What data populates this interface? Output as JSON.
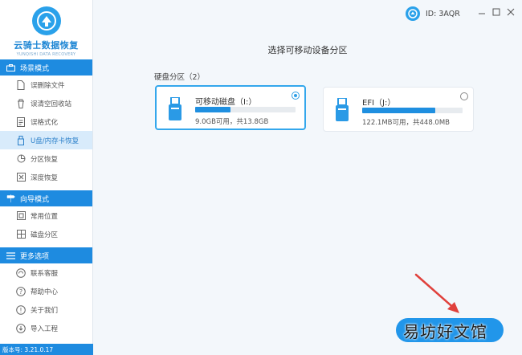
{
  "app": {
    "name": "云骑士数据恢复",
    "subtitle": "YUNQISHI DATA RECOVERY",
    "version_label": "版本号: 3.21.0.17"
  },
  "sidebar": {
    "sections": [
      {
        "title": "场景模式",
        "icon": "briefcase-icon",
        "items": [
          {
            "label": "误删除文件",
            "icon": "document-icon"
          },
          {
            "label": "误清空回收站",
            "icon": "recycle-bin-icon"
          },
          {
            "label": "误格式化",
            "icon": "format-icon"
          },
          {
            "label": "U盘/内存卡恢复",
            "icon": "usb-drive-icon",
            "active": true
          },
          {
            "label": "分区恢复",
            "icon": "partition-icon"
          },
          {
            "label": "深度恢复",
            "icon": "deep-scan-icon"
          }
        ]
      },
      {
        "title": "向导模式",
        "icon": "signpost-icon",
        "items": [
          {
            "label": "常用位置",
            "icon": "location-icon"
          },
          {
            "label": "磁盘分区",
            "icon": "disk-icon"
          }
        ]
      },
      {
        "title": "更多选项",
        "icon": "menu-icon",
        "items": [
          {
            "label": "联系客服",
            "icon": "headset-icon"
          },
          {
            "label": "帮助中心",
            "icon": "help-icon"
          },
          {
            "label": "关于我们",
            "icon": "info-icon"
          },
          {
            "label": "导入工程",
            "icon": "import-icon"
          }
        ]
      }
    ]
  },
  "header": {
    "user_id": "ID: 3AQR",
    "controls": [
      "minimize",
      "maximize",
      "close"
    ]
  },
  "main": {
    "title": "选择可移动设备分区",
    "disk_group_label": "硬盘分区（2）",
    "disks": [
      {
        "name": "可移动磁盘（I:）",
        "info": "9.0GB可用，共13.8GB",
        "used_fraction": 0.35,
        "selected": true
      },
      {
        "name": "EFI（J:）",
        "info": "122.1MB可用，共448.0MB",
        "used_fraction": 0.73,
        "selected": false
      }
    ]
  },
  "watermark": "易坊好文馆",
  "colors": {
    "accent": "#1e8be0",
    "bar_fill": "#1f8fe0",
    "arrow": "#e0413c",
    "active_item_bg": "#d8ebfb"
  }
}
